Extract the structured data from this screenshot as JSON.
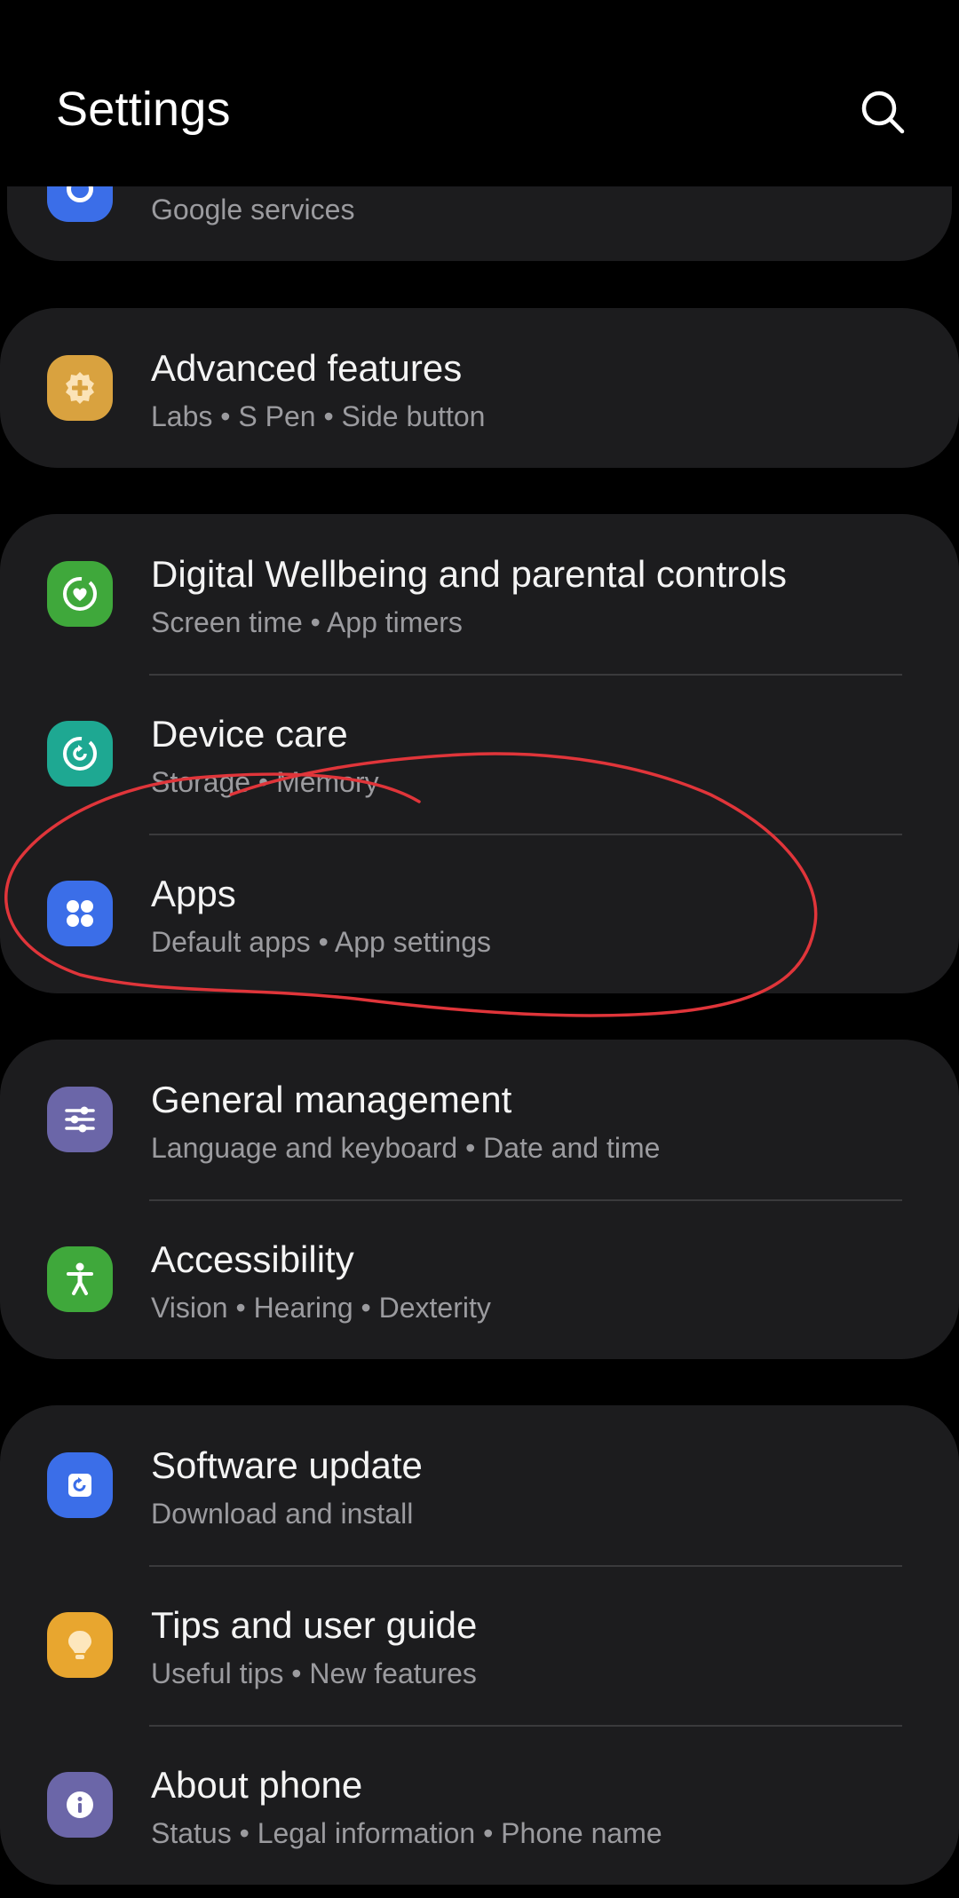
{
  "header": {
    "title": "Settings",
    "search_icon": "search-icon"
  },
  "partial_item": {
    "subtitle": "Google services",
    "icon": "google-icon",
    "icon_color": "#3b6ee8"
  },
  "advanced": {
    "title": "Advanced features",
    "subtitle": "Labs  •  S Pen  •  Side button",
    "icon": "gear-plus-icon",
    "icon_color": "#d9a23f"
  },
  "wellbeing": {
    "title": "Digital Wellbeing and parental controls",
    "subtitle": "Screen time  •  App timers",
    "icon": "heart-circle-icon",
    "icon_color": "#3fa83b"
  },
  "device_care": {
    "title": "Device care",
    "subtitle": "Storage  •  Memory",
    "icon": "refresh-circle-icon",
    "icon_color": "#1ea892"
  },
  "apps": {
    "title": "Apps",
    "subtitle": "Default apps  •  App settings",
    "icon": "dots-grid-icon",
    "icon_color": "#3b6ee8"
  },
  "general": {
    "title": "General management",
    "subtitle": "Language and keyboard  •  Date and time",
    "icon": "sliders-icon",
    "icon_color": "#6b66a8"
  },
  "accessibility": {
    "title": "Accessibility",
    "subtitle": "Vision  •  Hearing  •  Dexterity",
    "icon": "person-icon",
    "icon_color": "#3fa83b"
  },
  "software": {
    "title": "Software update",
    "subtitle": "Download and install",
    "icon": "update-icon",
    "icon_color": "#3b6ee8"
  },
  "tips": {
    "title": "Tips and user guide",
    "subtitle": "Useful tips  •  New features",
    "icon": "lightbulb-icon",
    "icon_color": "#e8a62f"
  },
  "about": {
    "title": "About phone",
    "subtitle": "Status  •  Legal information  •  Phone name",
    "icon": "info-icon",
    "icon_color": "#6b66a8"
  },
  "annotation_color": "#e0353a"
}
